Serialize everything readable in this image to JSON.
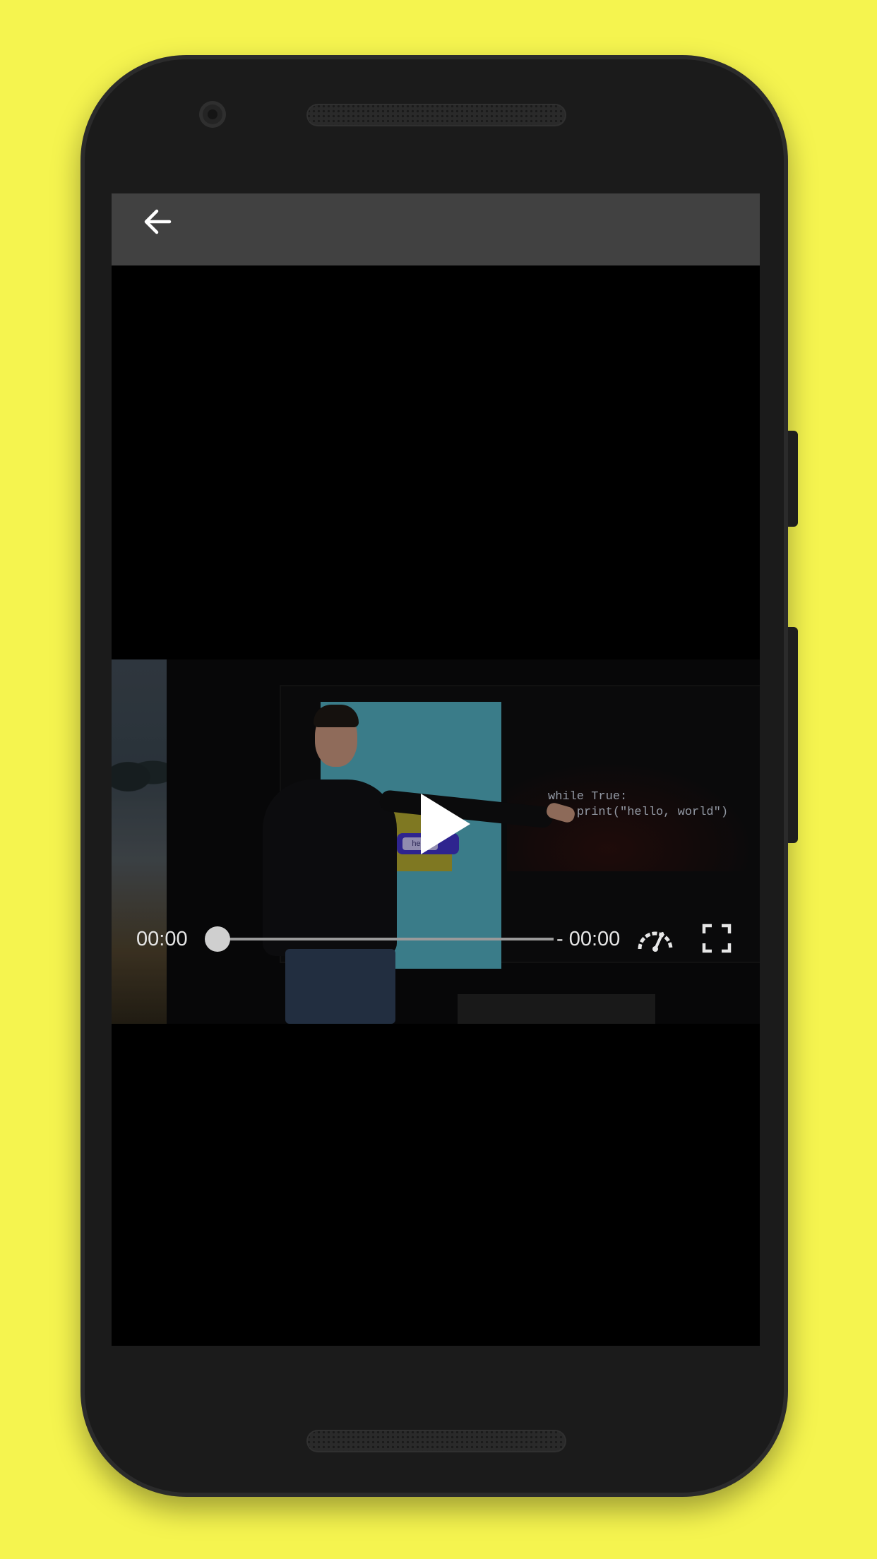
{
  "app": {
    "back_icon": "arrow-back-icon"
  },
  "video": {
    "slide_code": "while True:\n    print(\"hello, world\")",
    "slide_block_text": "hello",
    "play_icon": "play-icon"
  },
  "player": {
    "current_time": "00:00",
    "remaining_time": "- 00:00",
    "progress": 0,
    "speed_icon": "speedometer-icon",
    "fullscreen_icon": "fullscreen-icon"
  },
  "colors": {
    "background": "#f5f44f",
    "app_bar": "#414141",
    "screen": "#000000",
    "control_text": "#e6e6e6"
  }
}
